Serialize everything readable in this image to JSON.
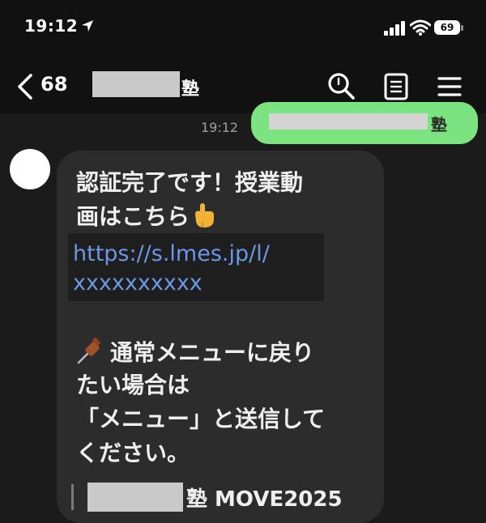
{
  "status_bar": {
    "time": "19:12",
    "battery": "69"
  },
  "header": {
    "unread_count": "68",
    "chat_name_suffix": "塾"
  },
  "sent_message": {
    "time": "19:12",
    "text_suffix": "塾"
  },
  "received_message": {
    "line1": "認証完了です！授業動",
    "line2": "画はこちら",
    "link_line1": "https://s.lmes.jp/l/",
    "link_line2": "xxxxxxxxxx",
    "line3": "通常メニューに戻り",
    "line4": "たい場合は",
    "line5": "「メニュー」と送信して",
    "line6": "ください。",
    "footer_suffix": "塾 MOVE2025"
  },
  "colors": {
    "link": "#6a98e6",
    "sent_bubble": "#7be37f",
    "received_bubble": "#2c2c2c"
  }
}
